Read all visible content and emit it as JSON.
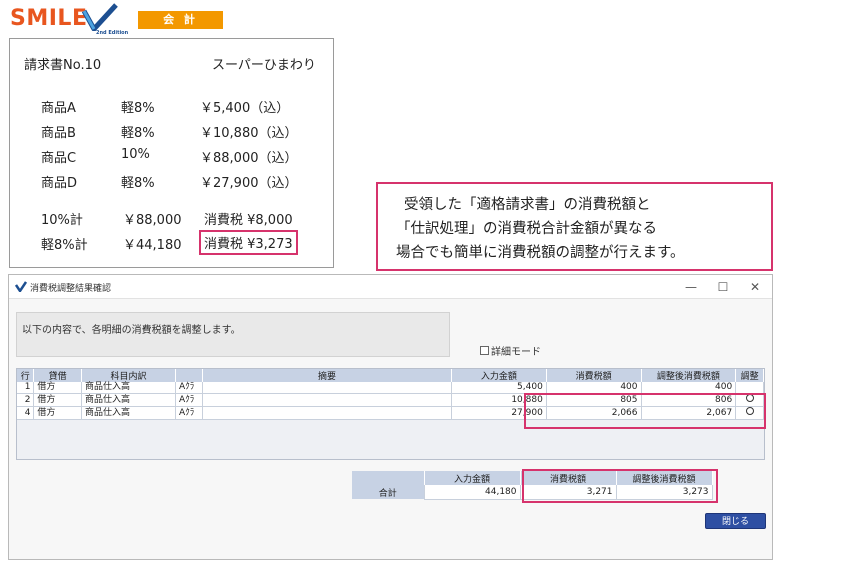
{
  "logo": {
    "text": "SMILE",
    "edition": "2nd Edition",
    "badge": "会 計"
  },
  "invoice": {
    "number": "請求書No.10",
    "shop": "スーパーひまわり",
    "items": [
      {
        "name": "商品A",
        "rate": "軽8%",
        "amount": "￥5,400（込）"
      },
      {
        "name": "商品B",
        "rate": "軽8%",
        "amount": "￥10,880（込）"
      },
      {
        "name": "商品C",
        "rate": "10%",
        "amount": "￥88,000（込）"
      },
      {
        "name": "商品D",
        "rate": "軽8%",
        "amount": "￥27,900（込）"
      }
    ],
    "summary": [
      {
        "label": "10%計",
        "amount": "￥88,000",
        "tax": "消費税 ¥8,000"
      },
      {
        "label": "軽8%計",
        "amount": "￥44,180",
        "tax": "消費税 ¥3,273"
      }
    ]
  },
  "callout": {
    "lines": [
      "受領した「適格請求書」の消費税額と",
      "「仕訳処理」の消費税合計金額が異なる",
      "場合でも簡単に消費税額の調整が行えます。"
    ]
  },
  "dialog": {
    "title": "消費税調整結果確認",
    "controls": {
      "minimize": "—",
      "maximize": "☐",
      "close": "✕"
    },
    "message": "以下の内容で、各明細の消費税額を調整します。",
    "detail_mode_label": "詳細モード",
    "grid": {
      "headers": [
        "行",
        "貸借",
        "科目内訳",
        "",
        "摘要",
        "入力金額",
        "消費税額",
        "調整後消費税額",
        "調整"
      ],
      "rows": [
        {
          "line": "1",
          "side": "借方",
          "account": "商品仕入高",
          "sub": "Aｸﾗ",
          "memo": "",
          "amount": "5,400",
          "tax": "400",
          "adj_tax": "400",
          "adjusted": false
        },
        {
          "line": "2",
          "side": "借方",
          "account": "商品仕入高",
          "sub": "Aｸﾗ",
          "memo": "",
          "amount": "10,880",
          "tax": "805",
          "adj_tax": "806",
          "adjusted": true
        },
        {
          "line": "4",
          "side": "借方",
          "account": "商品仕入高",
          "sub": "Aｸﾗ",
          "memo": "",
          "amount": "27,900",
          "tax": "2,066",
          "adj_tax": "2,067",
          "adjusted": true
        }
      ]
    },
    "totals": {
      "headers": [
        "入力金額",
        "消費税額",
        "調整後消費税額"
      ],
      "label": "合計",
      "amount": "44,180",
      "tax": "3,271",
      "adj_tax": "3,273"
    },
    "close_button": "閉じる"
  },
  "colors": {
    "accent_pink": "#d6336c",
    "logo_orange": "#e8561f",
    "badge_orange": "#f39800",
    "header_blue": "#c7d2e4",
    "button_blue": "#2e4fa3"
  }
}
